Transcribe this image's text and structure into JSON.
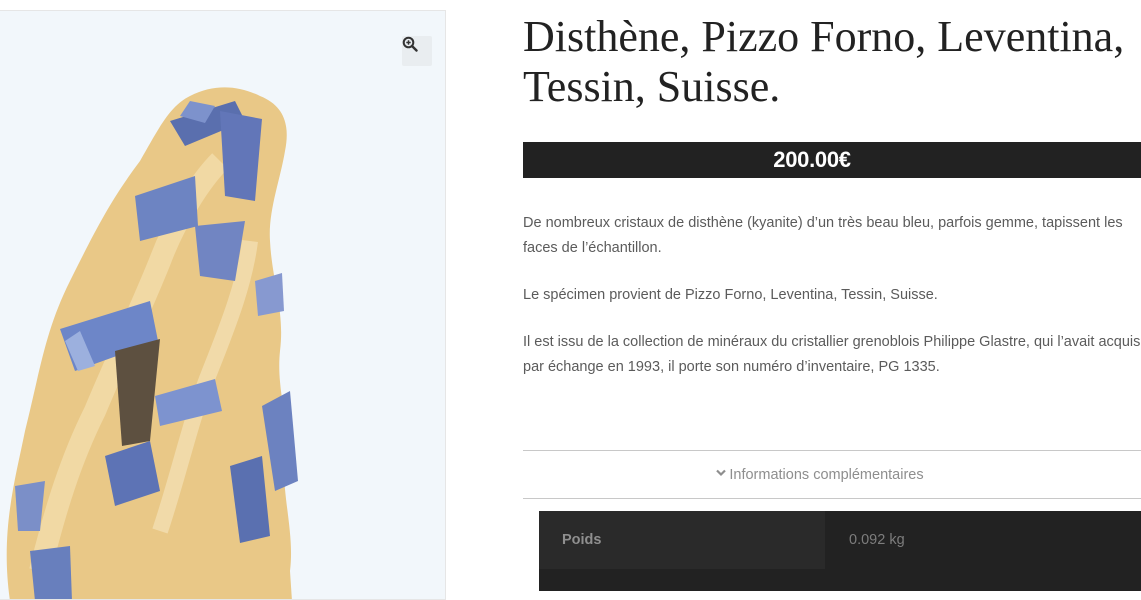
{
  "product": {
    "title_line1": "Disthène, Pizzo Forno, Leventina,",
    "title_line2": "Tessin, Suisse.",
    "price": "200.00€",
    "description": [
      "De nombreux cristaux de disthène (kyanite) d’un très beau bleu, parfois gemme, tapissent les",
      "faces de l’échantillon.",
      "Le spécimen provient de Pizzo Forno, Leventina, Tessin, Suisse.",
      "Il est issu de la collection de minéraux du cristallier grenoblois Philippe Glastre, qui l’avait acquis",
      "par échange en 1993, il porte son numéro d’inventaire, PG 1335."
    ]
  },
  "gallery": {
    "zoom_icon": "zoom-in-icon",
    "image_subject": "mineral-specimen"
  },
  "accordion": {
    "label": "Informations complémentaires",
    "icon": "chevron-down-icon"
  },
  "attributes": [
    {
      "label": "Poids",
      "value": "0.092 kg"
    }
  ]
}
